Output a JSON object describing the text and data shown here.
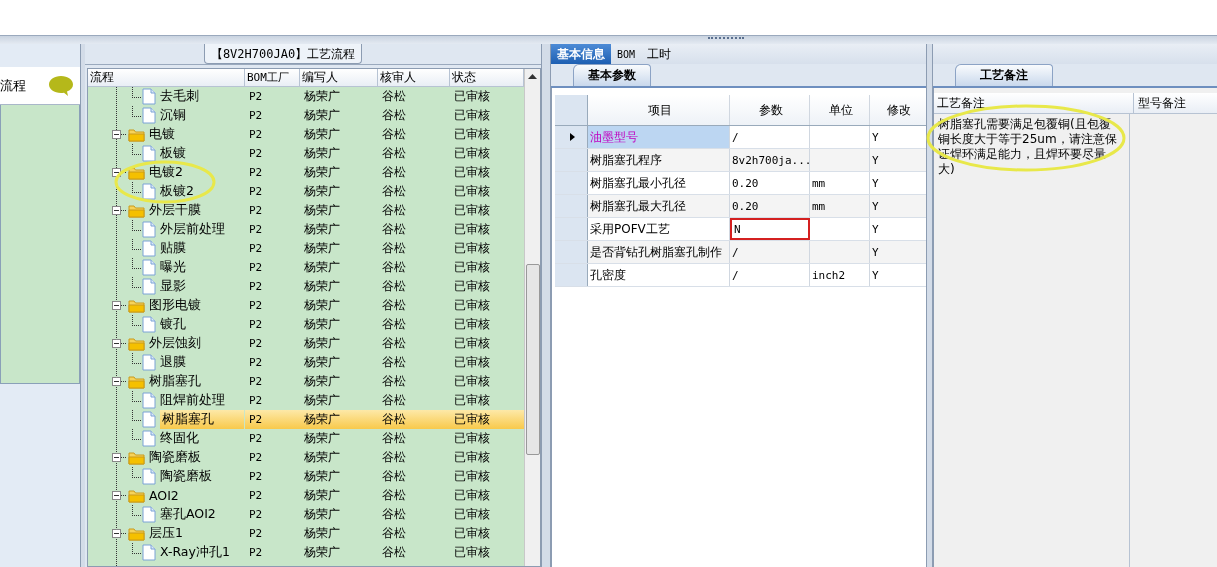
{
  "left_panel": {
    "title": "流程"
  },
  "tree_panel": {
    "title": "【8V2H700JA0】工艺流程",
    "columns": [
      "流程",
      "BOM工厂",
      "编写人",
      "核审人",
      "状态"
    ],
    "rows": [
      {
        "kind": "file",
        "label": "去毛刺",
        "bom": "P2",
        "author": "杨荣广",
        "reviewer": "谷松",
        "status": "已审核",
        "selected": false
      },
      {
        "kind": "file",
        "label": "沉铜",
        "bom": "P2",
        "author": "杨荣广",
        "reviewer": "谷松",
        "status": "已审核",
        "selected": false
      },
      {
        "kind": "folder",
        "label": "电镀",
        "bom": "P2",
        "author": "杨荣广",
        "reviewer": "谷松",
        "status": "已审核",
        "selected": false,
        "expanded": true,
        "circled": false,
        "children": [
          {
            "kind": "file",
            "label": "板镀",
            "bom": "P2",
            "author": "杨荣广",
            "reviewer": "谷松",
            "status": "已审核",
            "selected": false
          }
        ]
      },
      {
        "kind": "folder",
        "label": "电镀2",
        "bom": "P2",
        "author": "杨荣广",
        "reviewer": "谷松",
        "status": "已审核",
        "selected": false,
        "expanded": true,
        "circled": true,
        "children": [
          {
            "kind": "file",
            "label": "板镀2",
            "bom": "P2",
            "author": "杨荣广",
            "reviewer": "谷松",
            "status": "已审核",
            "selected": false
          }
        ]
      },
      {
        "kind": "folder",
        "label": "外层干膜",
        "bom": "P2",
        "author": "杨荣广",
        "reviewer": "谷松",
        "status": "已审核",
        "selected": false,
        "expanded": true,
        "circled": false,
        "children": [
          {
            "kind": "file",
            "label": "外层前处理",
            "bom": "P2",
            "author": "杨荣广",
            "reviewer": "谷松",
            "status": "已审核",
            "selected": false
          },
          {
            "kind": "file",
            "label": "贴膜",
            "bom": "P2",
            "author": "杨荣广",
            "reviewer": "谷松",
            "status": "已审核",
            "selected": false
          },
          {
            "kind": "file",
            "label": "曝光",
            "bom": "P2",
            "author": "杨荣广",
            "reviewer": "谷松",
            "status": "已审核",
            "selected": false
          },
          {
            "kind": "file",
            "label": "显影",
            "bom": "P2",
            "author": "杨荣广",
            "reviewer": "谷松",
            "status": "已审核",
            "selected": false
          }
        ]
      },
      {
        "kind": "folder",
        "label": "图形电镀",
        "bom": "P2",
        "author": "杨荣广",
        "reviewer": "谷松",
        "status": "已审核",
        "selected": false,
        "expanded": true,
        "circled": false,
        "children": [
          {
            "kind": "file",
            "label": "镀孔",
            "bom": "P2",
            "author": "杨荣广",
            "reviewer": "谷松",
            "status": "已审核",
            "selected": false
          }
        ]
      },
      {
        "kind": "folder",
        "label": "外层蚀刻",
        "bom": "P2",
        "author": "杨荣广",
        "reviewer": "谷松",
        "status": "已审核",
        "selected": false,
        "expanded": true,
        "circled": false,
        "children": [
          {
            "kind": "file",
            "label": "退膜",
            "bom": "P2",
            "author": "杨荣广",
            "reviewer": "谷松",
            "status": "已审核",
            "selected": false
          }
        ]
      },
      {
        "kind": "folder",
        "label": "树脂塞孔",
        "bom": "P2",
        "author": "杨荣广",
        "reviewer": "谷松",
        "status": "已审核",
        "selected": false,
        "expanded": true,
        "circled": false,
        "children": [
          {
            "kind": "file",
            "label": "阻焊前处理",
            "bom": "P2",
            "author": "杨荣广",
            "reviewer": "谷松",
            "status": "已审核",
            "selected": false
          },
          {
            "kind": "file",
            "label": "树脂塞孔",
            "bom": "P2",
            "author": "杨荣广",
            "reviewer": "谷松",
            "status": "已审核",
            "selected": true
          },
          {
            "kind": "file",
            "label": "终固化",
            "bom": "P2",
            "author": "杨荣广",
            "reviewer": "谷松",
            "status": "已审核",
            "selected": false
          }
        ]
      },
      {
        "kind": "folder",
        "label": "陶瓷磨板",
        "bom": "P2",
        "author": "杨荣广",
        "reviewer": "谷松",
        "status": "已审核",
        "selected": false,
        "expanded": true,
        "circled": false,
        "children": [
          {
            "kind": "file",
            "label": "陶瓷磨板",
            "bom": "P2",
            "author": "杨荣广",
            "reviewer": "谷松",
            "status": "已审核",
            "selected": false
          }
        ]
      },
      {
        "kind": "folder",
        "label": "AOI2",
        "bom": "P2",
        "author": "杨荣广",
        "reviewer": "谷松",
        "status": "已审核",
        "selected": false,
        "expanded": true,
        "circled": false,
        "children": [
          {
            "kind": "file",
            "label": "塞孔AOI2",
            "bom": "P2",
            "author": "杨荣广",
            "reviewer": "谷松",
            "status": "已审核",
            "selected": false
          }
        ]
      },
      {
        "kind": "folder",
        "label": "层压1",
        "bom": "P2",
        "author": "杨荣广",
        "reviewer": "谷松",
        "status": "已审核",
        "selected": false,
        "expanded": true,
        "circled": false,
        "children": [
          {
            "kind": "file",
            "label": "X-Ray冲孔1",
            "bom": "P2",
            "author": "杨荣广",
            "reviewer": "谷松",
            "status": "已审核",
            "selected": false
          }
        ]
      }
    ]
  },
  "tabs": [
    {
      "label": "基本信息",
      "selected": true
    },
    {
      "label": "BOM",
      "selected": false
    },
    {
      "label": "工时",
      "selected": false
    }
  ],
  "params": {
    "tab": "基本参数",
    "columns": [
      "项目",
      "参数",
      "单位",
      "修改"
    ],
    "rows": [
      {
        "item": "油墨型号",
        "value": "/",
        "unit": "",
        "edit": "Y",
        "selected": true,
        "boxed": false
      },
      {
        "item": "树脂塞孔程序",
        "value": "8v2h700ja...",
        "edit": "Y",
        "selected": false,
        "boxed": false
      },
      {
        "item": "树脂塞孔最小孔径",
        "value": "0.20",
        "unit": "mm",
        "edit": "Y",
        "selected": false,
        "boxed": false
      },
      {
        "item": "树脂塞孔最大孔径",
        "value": "0.20",
        "unit": "mm",
        "edit": "Y",
        "selected": false,
        "boxed": false
      },
      {
        "item": "采用POFV工艺",
        "value": "N",
        "edit": "Y",
        "selected": false,
        "boxed": true
      },
      {
        "item": "是否背钻孔树脂塞孔制作",
        "value": "/",
        "edit": "Y",
        "selected": false,
        "boxed": false
      },
      {
        "item": "孔密度",
        "value": "/",
        "unit": "inch2",
        "edit": "Y",
        "selected": false,
        "boxed": false
      }
    ]
  },
  "remarks": {
    "tab": "工艺备注",
    "columns": [
      "工艺备注",
      "型号备注"
    ],
    "text": "树脂塞孔需要满足包覆铜(且包覆铜长度大于等于25um，请注意保证焊环满足能力，且焊环要尽量大)",
    "circled": true
  }
}
